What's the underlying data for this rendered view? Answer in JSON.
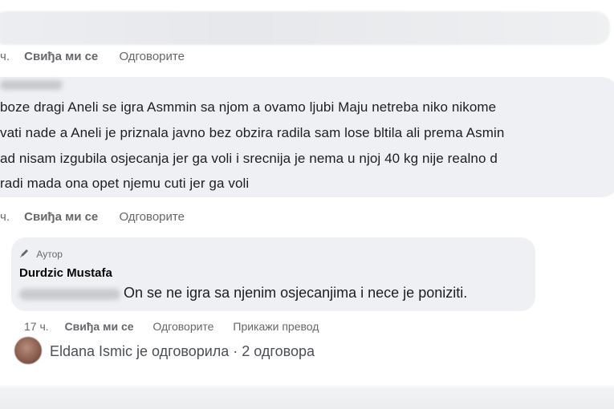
{
  "top_comment": {
    "actions": {
      "time_fragment": "ч.",
      "like_label": "Свиђа ми се",
      "reply_label": "Одговорите"
    }
  },
  "main_comment": {
    "lines": [
      "boze dragi Aneli se igra Asmmin sa njom a ovamo ljubi Maju netreba niko nikome",
      "vati nade a Aneli je priznala javno bez obzira radila sam lose bltila ali prema Asmin",
      "ad nisam izgubila osjecanja jer ga voli i srecnija je nema u njoj 40 kg nije realno d",
      "radi mada ona opet njemu cuti jer ga voli"
    ],
    "actions": {
      "time_fragment": "ч.",
      "like_label": "Свиђа ми се",
      "reply_label": "Одговорите"
    }
  },
  "reply": {
    "author_badge": "Аутор",
    "author_name": "Durdzic Mustafa",
    "text": "On se ne igra sa njenim osjecanjima i nece je poniziti.",
    "actions": {
      "time": "17 ч.",
      "like_label": "Свиђа ми се",
      "reply_label": "Одговорите",
      "translate_label": "Прикажи превод"
    }
  },
  "replies_summary": {
    "text": "Eldana Ismic је одговорила · 2 одговора"
  }
}
